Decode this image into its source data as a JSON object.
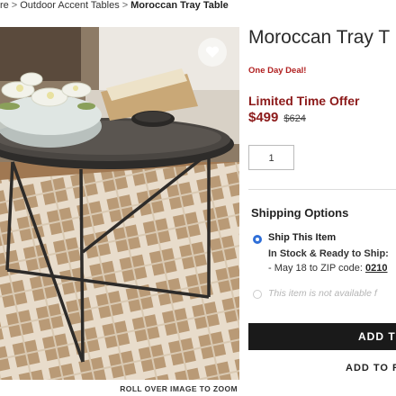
{
  "breadcrumb": {
    "items": [
      "re",
      "Outdoor Accent Tables"
    ],
    "separator": ">",
    "current": "Moroccan Tray Table"
  },
  "product": {
    "title": "Moroccan Tray T",
    "deal_badge": "One Day Deal!",
    "offer_label": "Limited Time Offer",
    "price_sale": "$499",
    "price_original": "$624",
    "quantity": "1"
  },
  "shipping": {
    "heading": "Shipping Options",
    "option_label": "Ship This Item",
    "stock_line": "In Stock & Ready to Ship:",
    "date_prefix": "- May 18 to ZIP code: ",
    "zip": "0210",
    "unavailable_text": "This item is not available f"
  },
  "actions": {
    "add_to_cart": "ADD TO",
    "add_to_registry": "ADD TO R"
  },
  "image": {
    "zoom_hint": "ROLL OVER IMAGE TO ZOOM",
    "favorite_icon": "heart-icon"
  },
  "colors": {
    "price_red": "#8c1a1a",
    "deal_red": "#b01e1e",
    "radio_blue": "#2f6fd8",
    "button_black": "#1a1a1a"
  }
}
